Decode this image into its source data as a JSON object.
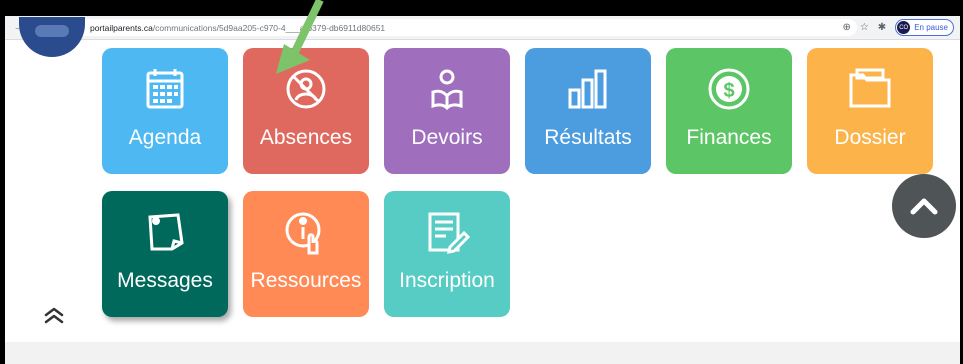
{
  "browser": {
    "url_host": "portailparents.ca",
    "url_path": "/communications/5d9aa205-c970-4___a-b379-db6911d80651",
    "profile_initials": "CO",
    "profile_status": "En pause"
  },
  "tiles": [
    {
      "label": "Agenda",
      "icon": "calendar-icon",
      "color": "#4db8f2"
    },
    {
      "label": "Absences",
      "icon": "no-person-icon",
      "color": "#e0695f"
    },
    {
      "label": "Devoirs",
      "icon": "reader-icon",
      "color": "#9f6fbe"
    },
    {
      "label": "Résultats",
      "icon": "bar-chart-icon",
      "color": "#4b9de0"
    },
    {
      "label": "Finances",
      "icon": "dollar-coin-icon",
      "color": "#5cc565"
    },
    {
      "label": "Dossier",
      "icon": "folder-icon",
      "color": "#fbb34a"
    },
    {
      "label": "Messages",
      "icon": "sticky-note-icon",
      "color": "#00695c"
    },
    {
      "label": "Ressources",
      "icon": "info-hand-icon",
      "color": "#ff8a55"
    },
    {
      "label": "Inscription",
      "icon": "form-pen-icon",
      "color": "#56ccc4"
    }
  ],
  "annotation_arrow_color": "#7cc36a"
}
